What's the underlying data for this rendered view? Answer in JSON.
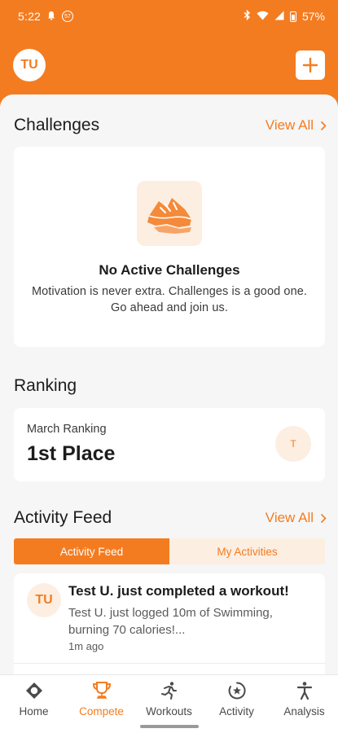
{
  "status_bar": {
    "time": "5:22",
    "badge": "57",
    "battery": "57%"
  },
  "header": {
    "avatar_initials": "TU",
    "add_button_icon": "plus-icon"
  },
  "challenges": {
    "title": "Challenges",
    "view_all": "View All",
    "empty_icon": "running-shoe-icon",
    "empty_title": "No Active Challenges",
    "empty_description": "Motivation is never extra. Challenges is a good one. Go ahead and join us."
  },
  "ranking": {
    "title": "Ranking",
    "label": "March Ranking",
    "value": "1st Place",
    "avatar_initial": "T"
  },
  "activity_feed": {
    "title": "Activity Feed",
    "view_all": "View All",
    "tabs": [
      {
        "label": "Activity Feed",
        "active": true
      },
      {
        "label": "My Activities",
        "active": false
      }
    ],
    "items": [
      {
        "avatar_initials": "TU",
        "title": "Test U. just completed a workout!",
        "body": "Test U. just logged 10m of Swimming, burning 70 calories!...",
        "time": "1m ago"
      }
    ]
  },
  "bottom_nav": {
    "items": [
      {
        "label": "Home",
        "icon": "home-icon",
        "active": false
      },
      {
        "label": "Compete",
        "icon": "trophy-icon",
        "active": true
      },
      {
        "label": "Workouts",
        "icon": "running-person-icon",
        "active": false
      },
      {
        "label": "Activity",
        "icon": "activity-icon",
        "active": false
      },
      {
        "label": "Analysis",
        "icon": "person-icon",
        "active": false
      }
    ]
  },
  "colors": {
    "accent": "#f47c20",
    "accent_light": "#fdeee2",
    "background": "#f6f6f6"
  }
}
